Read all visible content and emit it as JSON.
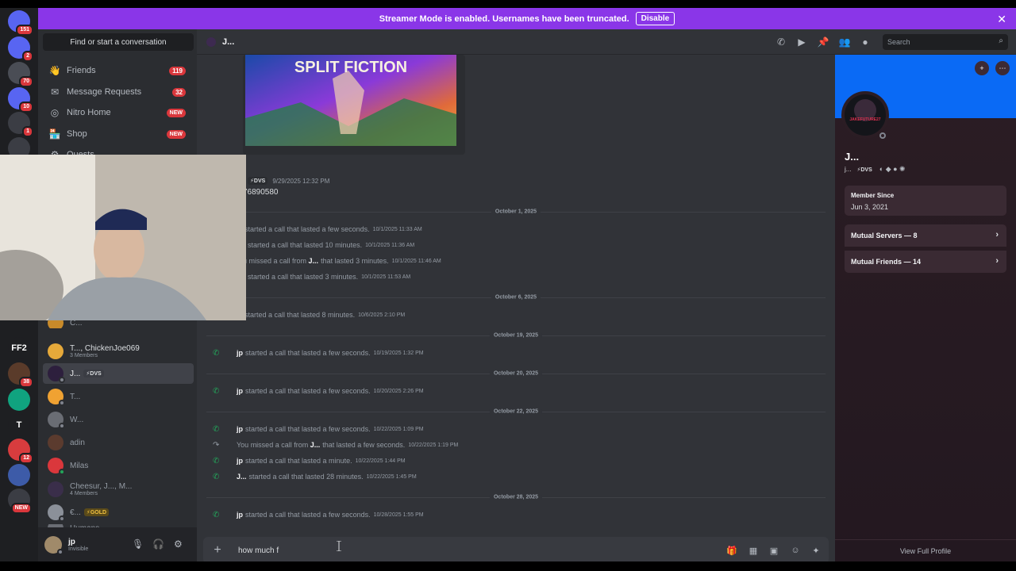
{
  "banner": {
    "text": "Streamer Mode is enabled. Usernames have been truncated.",
    "disable_label": "Disable",
    "color": "#8a36e8"
  },
  "rail": {
    "servers": [
      {
        "label": "",
        "badge": "151",
        "color": "#5865f2",
        "icon": "discord-home-icon"
      },
      {
        "label": "",
        "badge": "2",
        "color": "#5865f2",
        "icon": "discord-icon"
      },
      {
        "label": "",
        "badge": "70",
        "color": "#4a4d55",
        "icon": "avatar-icon"
      },
      {
        "label": "",
        "badge": "10",
        "color": "#5865f2",
        "icon": "discord-icon"
      },
      {
        "label": "",
        "badge": "1",
        "color": "#3b3d44",
        "icon": "avatar-icon"
      },
      {
        "label": "",
        "badge": "",
        "color": "#3b3d44",
        "icon": "avatar-icon"
      },
      {
        "label": "FF2",
        "badge": "",
        "color": "#1e1f22",
        "icon": "ff2-icon"
      },
      {
        "label": "",
        "badge": "38",
        "color": "#5a3b2a",
        "icon": "avatar-icon"
      },
      {
        "label": "",
        "badge": "",
        "color": "#10a37f",
        "icon": "openai-icon"
      },
      {
        "label": "T",
        "badge": "",
        "color": "#1e1f22",
        "icon": "t-icon"
      },
      {
        "label": "",
        "badge": "12",
        "color": "#d83c3e",
        "icon": "avatar-icon"
      },
      {
        "label": "",
        "badge": "",
        "color": "#3d5ba8",
        "icon": "avatar-icon"
      },
      {
        "label": "",
        "badge": "NEW",
        "color": "#3b3d44",
        "icon": "avatar-icon"
      }
    ]
  },
  "dm": {
    "search_placeholder": "Find or start a conversation",
    "nav": [
      {
        "label": "Friends",
        "count": "119",
        "icon": "friends-icon"
      },
      {
        "label": "Message Requests",
        "count": "32",
        "icon": "envelope-icon"
      },
      {
        "label": "Nitro Home",
        "count": "NEW",
        "icon": "nitro-icon"
      },
      {
        "label": "Shop",
        "count": "NEW",
        "icon": "shop-icon"
      },
      {
        "label": "Quests",
        "count": "",
        "icon": "quests-icon"
      }
    ],
    "items": [
      {
        "name": "T..., ChickenJoe069",
        "sub": "3 Members",
        "tag": ""
      },
      {
        "name": "J...",
        "sub": "",
        "tag": "⚡DVS"
      },
      {
        "name": "T...",
        "sub": "",
        "tag": ""
      },
      {
        "name": "W...",
        "sub": "",
        "tag": ""
      },
      {
        "name": "adin",
        "sub": "",
        "tag": ""
      },
      {
        "name": "Milas",
        "sub": "",
        "tag": ""
      },
      {
        "name": "Cheesur, J..., M...",
        "sub": "4 Members",
        "tag": ""
      },
      {
        "name": "€...",
        "sub": "",
        "tag": "⚡GOLD"
      },
      {
        "name": "Humans",
        "sub": "",
        "tag": ""
      }
    ],
    "partial_top": "C..."
  },
  "user": {
    "name": "jp",
    "status": "Invisible"
  },
  "header": {
    "title": "J...",
    "search_placeholder": "Search"
  },
  "chat": {
    "embed_title": "SPLIT FICTION",
    "msg": {
      "tag": "⚡DVS",
      "time": "9/29/2025 12:32 PM",
      "text": "76890580"
    },
    "dividers": [
      "October 1, 2025",
      "October 6, 2025",
      "October 19, 2025",
      "October 20, 2025",
      "October 22, 2025",
      "October 28, 2025"
    ],
    "calls": [
      {
        "who": "",
        "text": "started a call that lasted a few seconds.",
        "ts": "10/1/2025 11:33 AM",
        "missed": false
      },
      {
        "who": "",
        "text": "started a call that lasted 10 minutes.",
        "ts": "10/1/2025 11:36 AM",
        "missed": false
      },
      {
        "who": "J...",
        "pre": "u missed a call from",
        "text": "that lasted 3 minutes.",
        "ts": "10/1/2025 11:46 AM",
        "missed": true
      },
      {
        "who": "",
        "text": "started a call that lasted 3 minutes.",
        "ts": "10/1/2025 11:53 AM",
        "missed": false
      },
      {
        "who": "",
        "text": "started a call that lasted 8 minutes.",
        "ts": "10/6/2025 2:10 PM",
        "missed": false
      },
      {
        "who": "jp",
        "text": "started a call that lasted a few seconds.",
        "ts": "10/19/2025 1:32 PM",
        "missed": false
      },
      {
        "who": "jp",
        "text": "started a call that lasted a few seconds.",
        "ts": "10/20/2025 2:26 PM",
        "missed": false
      },
      {
        "who": "jp",
        "text": "started a call that lasted a few seconds.",
        "ts": "10/22/2025 1:09 PM",
        "missed": false
      },
      {
        "who": "J...",
        "pre": "You missed a call from",
        "text": "that lasted a few seconds.",
        "ts": "10/22/2025 1:19 PM",
        "missed": true
      },
      {
        "who": "jp",
        "text": "started a call that lasted a minute.",
        "ts": "10/22/2025 1:44 PM",
        "missed": false
      },
      {
        "who": "J...",
        "text": "started a call that lasted 28 minutes.",
        "ts": "10/22/2025 1:45 PM",
        "missed": false
      },
      {
        "who": "jp",
        "text": "started a call that lasted a few seconds.",
        "ts": "10/28/2025 1:55 PM",
        "missed": false
      }
    ],
    "input_value": "how much f"
  },
  "profile": {
    "name": "J...",
    "username": "j...",
    "tag": "⚡DVS",
    "avatar_text": "JAKEFUTURE27",
    "member_since_label": "Member Since",
    "member_since": "Jun 3, 2021",
    "mutual_servers": "Mutual Servers — 8",
    "mutual_friends": "Mutual Friends — 14",
    "view_full": "View Full Profile",
    "banner_color": "#0a6af5"
  }
}
